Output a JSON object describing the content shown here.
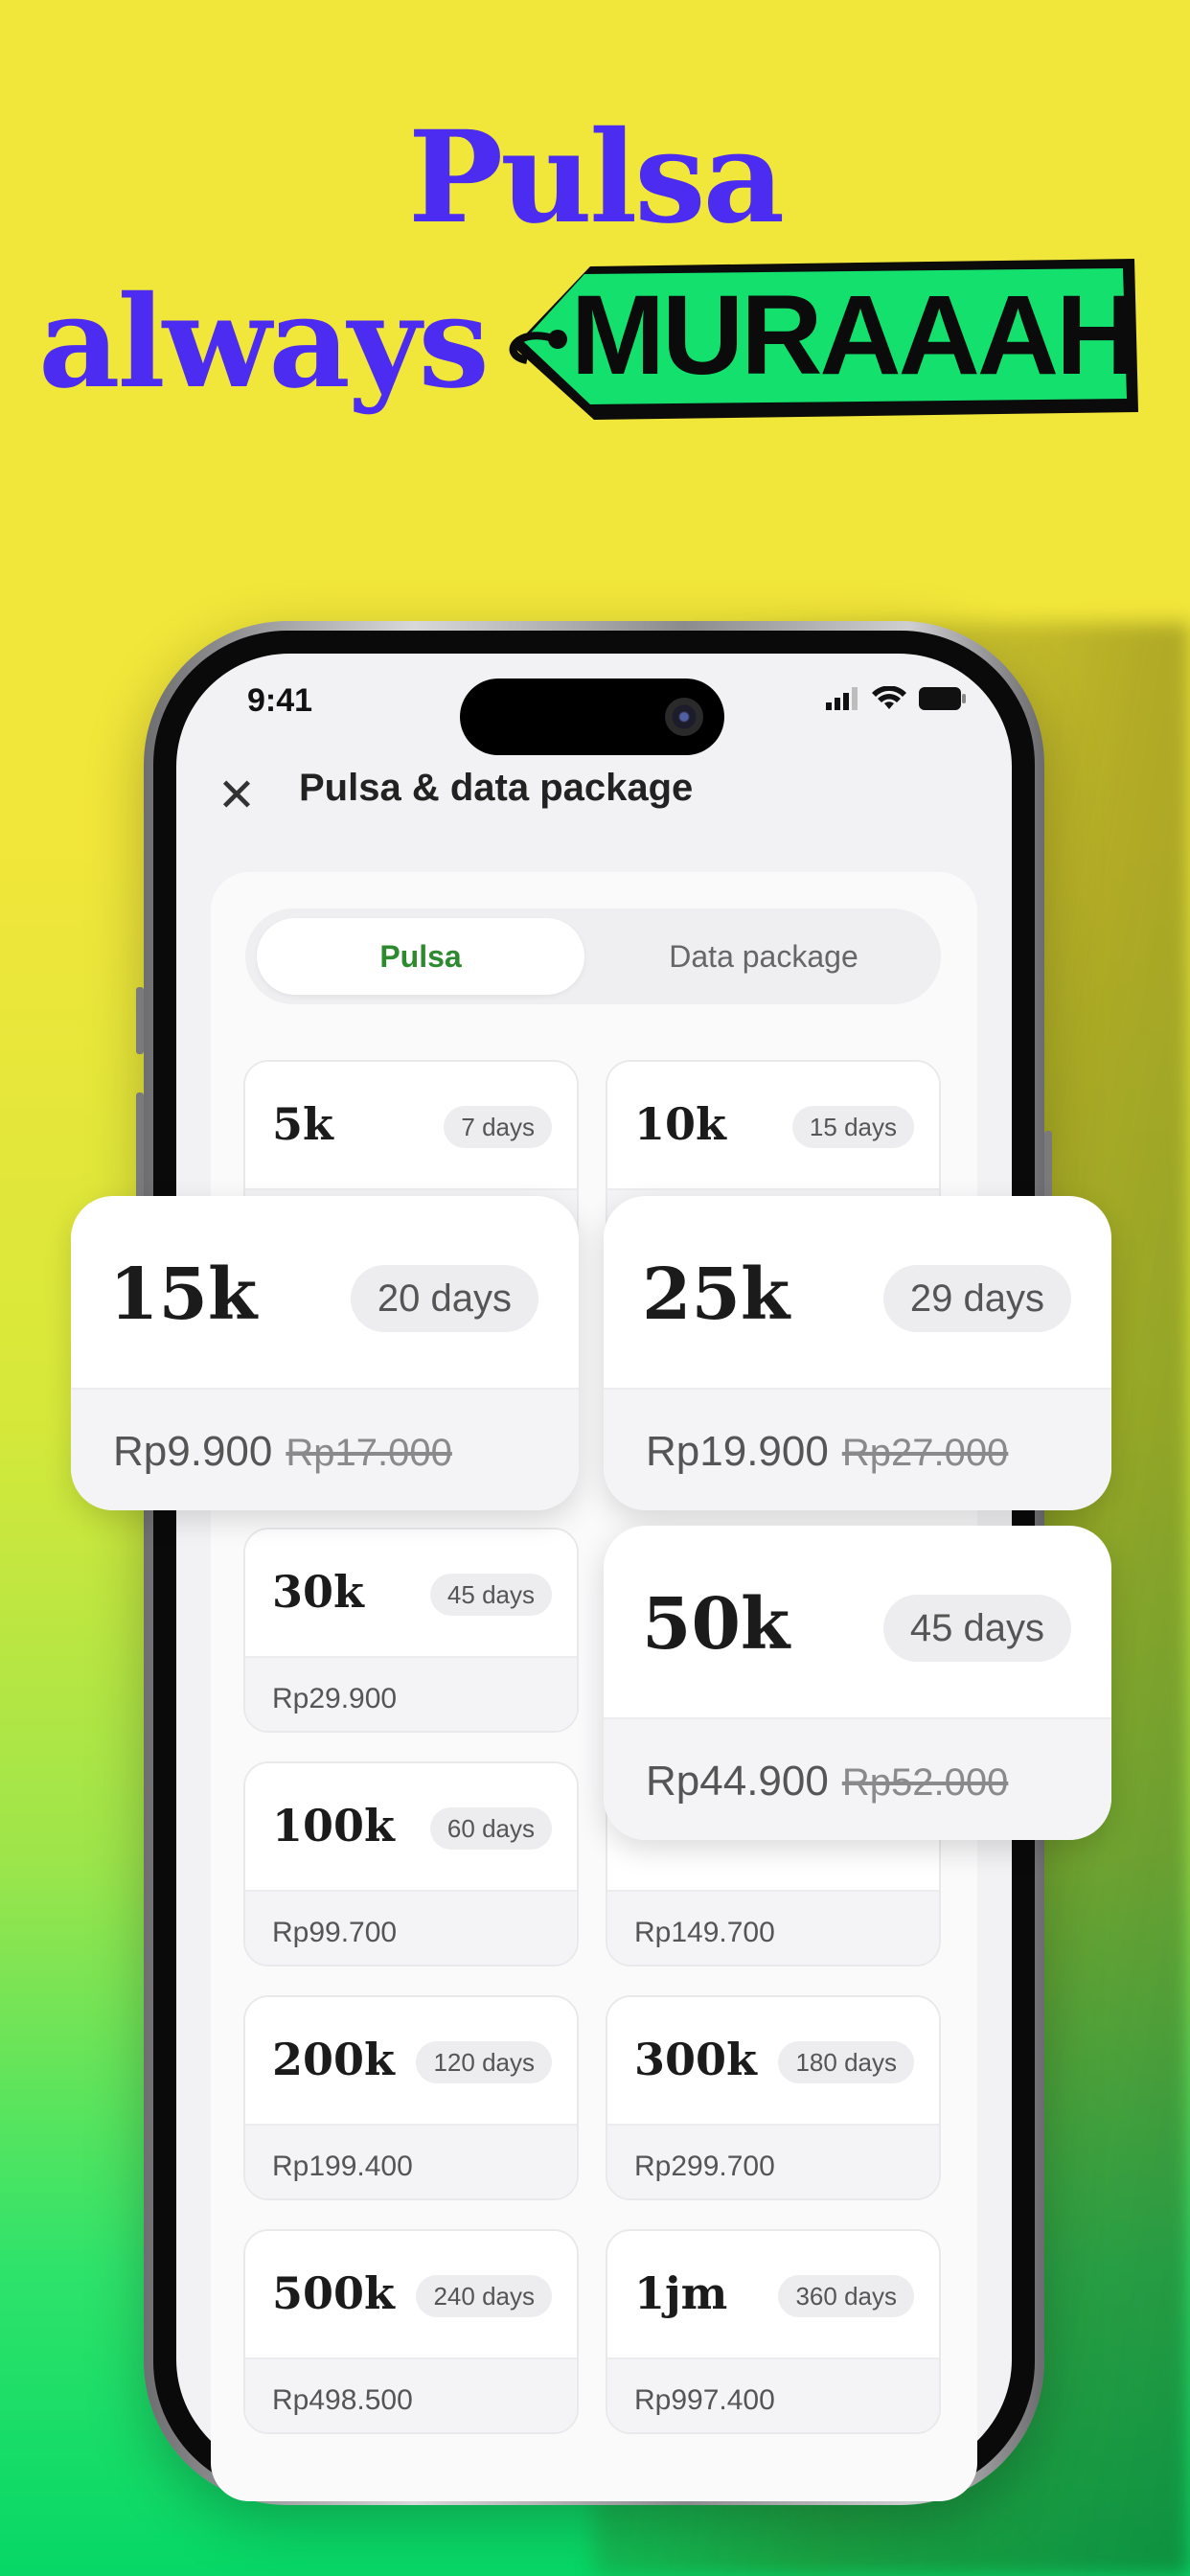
{
  "headline": {
    "line1": "Pulsa",
    "line2": "always",
    "tag": "MURAAAH"
  },
  "status_bar": {
    "time": "9:41",
    "icons": [
      "signal-icon",
      "wifi-icon",
      "battery-icon"
    ]
  },
  "header": {
    "title": "Pulsa & data package",
    "close_icon": "close-icon"
  },
  "tabs": [
    {
      "label": "Pulsa",
      "selected": true
    },
    {
      "label": "Data package",
      "selected": false
    }
  ],
  "packages": [
    {
      "amount": "5k",
      "days": "7 days",
      "price": ""
    },
    {
      "amount": "10k",
      "days": "15 days",
      "price": ""
    },
    {
      "amount": "30k",
      "days": "45 days",
      "price": "Rp29.900"
    },
    {
      "amount": "100k",
      "days": "60 days",
      "price": "Rp99.700"
    },
    {
      "amount": "",
      "days": "",
      "price": "Rp149.700"
    },
    {
      "amount": "200k",
      "days": "120 days",
      "price": "Rp199.400"
    },
    {
      "amount": "300k",
      "days": "180 days",
      "price": "Rp299.700"
    },
    {
      "amount": "500k",
      "days": "240 days",
      "price": "Rp498.500"
    },
    {
      "amount": "1jm",
      "days": "360 days",
      "price": "Rp997.400"
    }
  ],
  "featured": [
    {
      "amount": "15k",
      "days": "20 days",
      "price": "Rp9.900",
      "old_price": "Rp17.000"
    },
    {
      "amount": "25k",
      "days": "29 days",
      "price": "Rp19.900",
      "old_price": "Rp27.000"
    },
    {
      "amount": "50k",
      "days": "45 days",
      "price": "Rp44.900",
      "old_price": "Rp52.000"
    }
  ],
  "colors": {
    "headline": "#4b2cf0",
    "tag_fill": "#13e06d",
    "selected_tab": "#2e8a2e"
  }
}
